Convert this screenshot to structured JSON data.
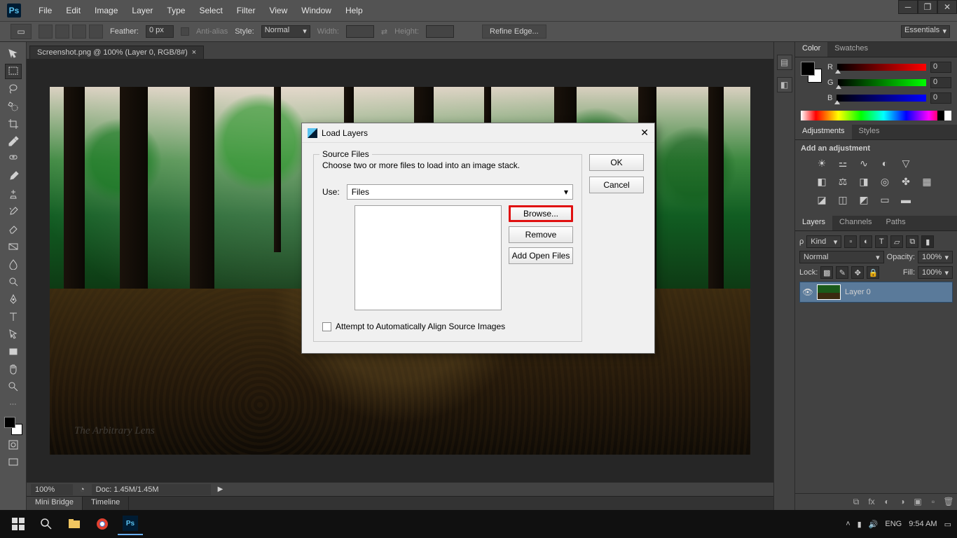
{
  "app": {
    "logo": "Ps"
  },
  "menus": [
    "File",
    "Edit",
    "Image",
    "Layer",
    "Type",
    "Select",
    "Filter",
    "View",
    "Window",
    "Help"
  ],
  "options": {
    "feather_label": "Feather:",
    "feather_value": "0 px",
    "antialias": "Anti-alias",
    "style_label": "Style:",
    "style_value": "Normal",
    "width_label": "Width:",
    "height_label": "Height:",
    "refine": "Refine Edge...",
    "workspace": "Essentials"
  },
  "doc": {
    "tab": "Screenshot.png @ 100% (Layer 0, RGB/8#)",
    "tab_x": "×",
    "watermark": "The Arbitrary Lens"
  },
  "status": {
    "zoom": "100%",
    "docinfo": "Doc: 1.45M/1.45M"
  },
  "bottom_tabs": {
    "mini": "Mini Bridge",
    "timeline": "Timeline"
  },
  "panels": {
    "color_tab": "Color",
    "swatches_tab": "Swatches",
    "r": "R",
    "g": "G",
    "b": "B",
    "rval": "0",
    "gval": "0",
    "bval": "0",
    "adjust_tab": "Adjustments",
    "styles_tab": "Styles",
    "adjust_title": "Add an adjustment",
    "layers_tab": "Layers",
    "channels_tab": "Channels",
    "paths_tab": "Paths",
    "kind_label": "Kind",
    "blend": "Normal",
    "opacity_label": "Opacity:",
    "opacity": "100%",
    "lock_label": "Lock:",
    "fill_label": "Fill:",
    "fill": "100%",
    "layer0": "Layer 0"
  },
  "dialog": {
    "title": "Load Layers",
    "fieldset": "Source Files",
    "desc": "Choose two or more files to load into an image stack.",
    "use_label": "Use:",
    "use_value": "Files",
    "browse": "Browse...",
    "remove": "Remove",
    "addopen": "Add Open Files",
    "align": "Attempt to Automatically Align Source Images",
    "ok": "OK",
    "cancel": "Cancel"
  },
  "taskbar": {
    "lang": "ENG",
    "time": "9:54 AM"
  }
}
